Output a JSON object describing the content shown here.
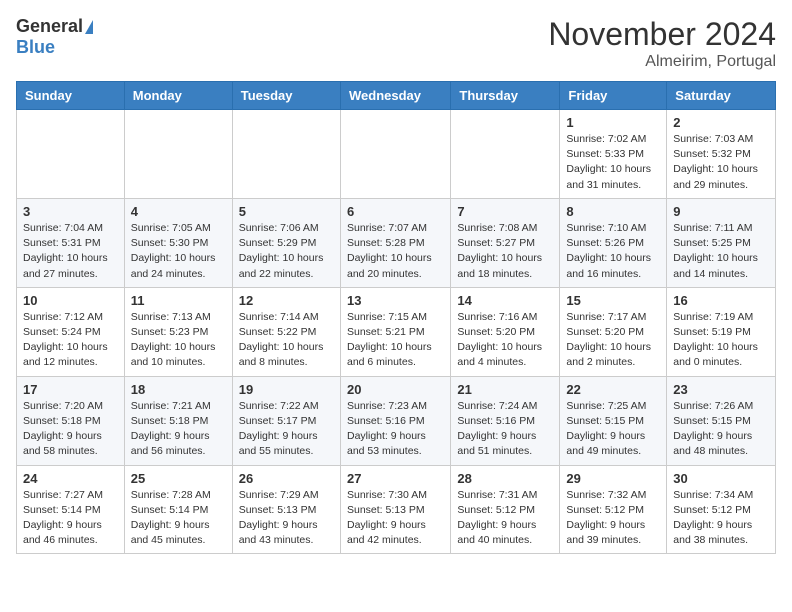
{
  "header": {
    "logo_general": "General",
    "logo_blue": "Blue",
    "month_title": "November 2024",
    "location": "Almeirim, Portugal"
  },
  "weekdays": [
    "Sunday",
    "Monday",
    "Tuesday",
    "Wednesday",
    "Thursday",
    "Friday",
    "Saturday"
  ],
  "weeks": [
    [
      {
        "day": "",
        "info": ""
      },
      {
        "day": "",
        "info": ""
      },
      {
        "day": "",
        "info": ""
      },
      {
        "day": "",
        "info": ""
      },
      {
        "day": "",
        "info": ""
      },
      {
        "day": "1",
        "info": "Sunrise: 7:02 AM\nSunset: 5:33 PM\nDaylight: 10 hours and 31 minutes."
      },
      {
        "day": "2",
        "info": "Sunrise: 7:03 AM\nSunset: 5:32 PM\nDaylight: 10 hours and 29 minutes."
      }
    ],
    [
      {
        "day": "3",
        "info": "Sunrise: 7:04 AM\nSunset: 5:31 PM\nDaylight: 10 hours and 27 minutes."
      },
      {
        "day": "4",
        "info": "Sunrise: 7:05 AM\nSunset: 5:30 PM\nDaylight: 10 hours and 24 minutes."
      },
      {
        "day": "5",
        "info": "Sunrise: 7:06 AM\nSunset: 5:29 PM\nDaylight: 10 hours and 22 minutes."
      },
      {
        "day": "6",
        "info": "Sunrise: 7:07 AM\nSunset: 5:28 PM\nDaylight: 10 hours and 20 minutes."
      },
      {
        "day": "7",
        "info": "Sunrise: 7:08 AM\nSunset: 5:27 PM\nDaylight: 10 hours and 18 minutes."
      },
      {
        "day": "8",
        "info": "Sunrise: 7:10 AM\nSunset: 5:26 PM\nDaylight: 10 hours and 16 minutes."
      },
      {
        "day": "9",
        "info": "Sunrise: 7:11 AM\nSunset: 5:25 PM\nDaylight: 10 hours and 14 minutes."
      }
    ],
    [
      {
        "day": "10",
        "info": "Sunrise: 7:12 AM\nSunset: 5:24 PM\nDaylight: 10 hours and 12 minutes."
      },
      {
        "day": "11",
        "info": "Sunrise: 7:13 AM\nSunset: 5:23 PM\nDaylight: 10 hours and 10 minutes."
      },
      {
        "day": "12",
        "info": "Sunrise: 7:14 AM\nSunset: 5:22 PM\nDaylight: 10 hours and 8 minutes."
      },
      {
        "day": "13",
        "info": "Sunrise: 7:15 AM\nSunset: 5:21 PM\nDaylight: 10 hours and 6 minutes."
      },
      {
        "day": "14",
        "info": "Sunrise: 7:16 AM\nSunset: 5:20 PM\nDaylight: 10 hours and 4 minutes."
      },
      {
        "day": "15",
        "info": "Sunrise: 7:17 AM\nSunset: 5:20 PM\nDaylight: 10 hours and 2 minutes."
      },
      {
        "day": "16",
        "info": "Sunrise: 7:19 AM\nSunset: 5:19 PM\nDaylight: 10 hours and 0 minutes."
      }
    ],
    [
      {
        "day": "17",
        "info": "Sunrise: 7:20 AM\nSunset: 5:18 PM\nDaylight: 9 hours and 58 minutes."
      },
      {
        "day": "18",
        "info": "Sunrise: 7:21 AM\nSunset: 5:18 PM\nDaylight: 9 hours and 56 minutes."
      },
      {
        "day": "19",
        "info": "Sunrise: 7:22 AM\nSunset: 5:17 PM\nDaylight: 9 hours and 55 minutes."
      },
      {
        "day": "20",
        "info": "Sunrise: 7:23 AM\nSunset: 5:16 PM\nDaylight: 9 hours and 53 minutes."
      },
      {
        "day": "21",
        "info": "Sunrise: 7:24 AM\nSunset: 5:16 PM\nDaylight: 9 hours and 51 minutes."
      },
      {
        "day": "22",
        "info": "Sunrise: 7:25 AM\nSunset: 5:15 PM\nDaylight: 9 hours and 49 minutes."
      },
      {
        "day": "23",
        "info": "Sunrise: 7:26 AM\nSunset: 5:15 PM\nDaylight: 9 hours and 48 minutes."
      }
    ],
    [
      {
        "day": "24",
        "info": "Sunrise: 7:27 AM\nSunset: 5:14 PM\nDaylight: 9 hours and 46 minutes."
      },
      {
        "day": "25",
        "info": "Sunrise: 7:28 AM\nSunset: 5:14 PM\nDaylight: 9 hours and 45 minutes."
      },
      {
        "day": "26",
        "info": "Sunrise: 7:29 AM\nSunset: 5:13 PM\nDaylight: 9 hours and 43 minutes."
      },
      {
        "day": "27",
        "info": "Sunrise: 7:30 AM\nSunset: 5:13 PM\nDaylight: 9 hours and 42 minutes."
      },
      {
        "day": "28",
        "info": "Sunrise: 7:31 AM\nSunset: 5:12 PM\nDaylight: 9 hours and 40 minutes."
      },
      {
        "day": "29",
        "info": "Sunrise: 7:32 AM\nSunset: 5:12 PM\nDaylight: 9 hours and 39 minutes."
      },
      {
        "day": "30",
        "info": "Sunrise: 7:34 AM\nSunset: 5:12 PM\nDaylight: 9 hours and 38 minutes."
      }
    ]
  ]
}
